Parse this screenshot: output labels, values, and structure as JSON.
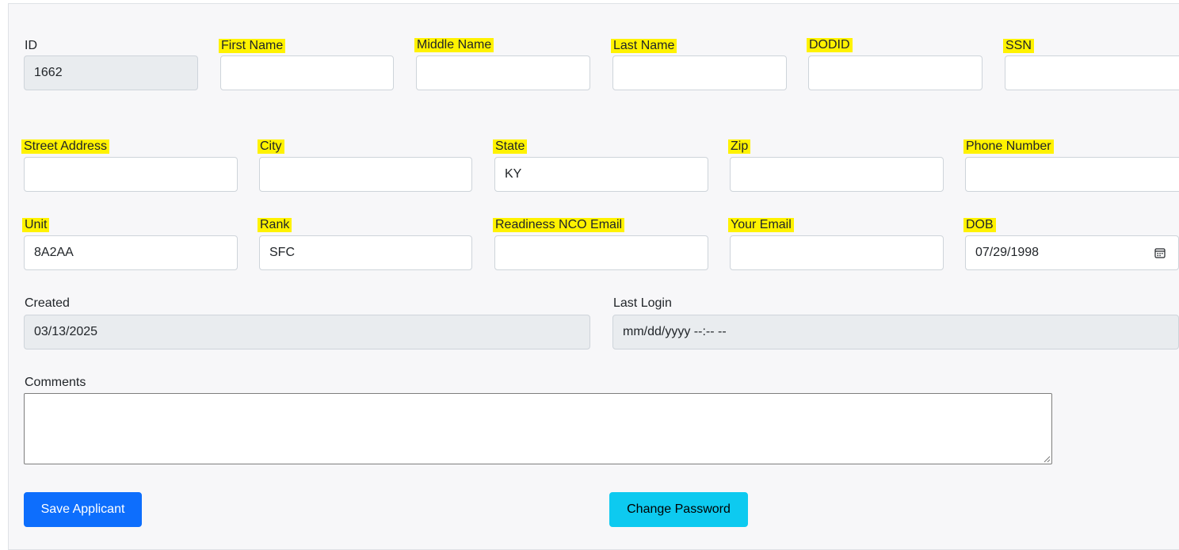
{
  "colors": {
    "highlight": "#fff200",
    "primary": "#0d6efd",
    "info": "#0dcaf0",
    "disabled_bg": "#e9ecef",
    "panel_bg": "#f7f7f9"
  },
  "row1": {
    "id": {
      "label": "ID",
      "value": "1662"
    },
    "first_name": {
      "label": "First Name",
      "value": ""
    },
    "middle_name": {
      "label": "Middle Name",
      "value": ""
    },
    "last_name": {
      "label": "Last Name",
      "value": ""
    },
    "dodid": {
      "label": "DODID",
      "value": ""
    },
    "ssn": {
      "label": "SSN",
      "value": ""
    }
  },
  "row2": {
    "street_address": {
      "label": "Street Address",
      "value": ""
    },
    "city": {
      "label": "City",
      "value": ""
    },
    "state": {
      "label": "State",
      "value": "KY"
    },
    "zip": {
      "label": "Zip",
      "value": ""
    },
    "phone_number": {
      "label": "Phone Number",
      "value": ""
    }
  },
  "row3": {
    "unit": {
      "label": "Unit",
      "value": "8A2AA"
    },
    "rank": {
      "label": "Rank",
      "value": "SFC"
    },
    "readiness_nco_email": {
      "label": "Readiness NCO Email",
      "value": ""
    },
    "your_email": {
      "label": "Your Email",
      "value": ""
    },
    "dob": {
      "label": "DOB",
      "value": "07/29/1998",
      "icon": "calendar-icon"
    }
  },
  "row4": {
    "created": {
      "label": "Created",
      "value": "03/13/2025"
    },
    "last_login": {
      "label": "Last Login",
      "value": "mm/dd/yyyy --:-- --"
    }
  },
  "comments": {
    "label": "Comments",
    "value": ""
  },
  "actions": {
    "save_label": "Save Applicant",
    "change_password_label": "Change Password"
  }
}
